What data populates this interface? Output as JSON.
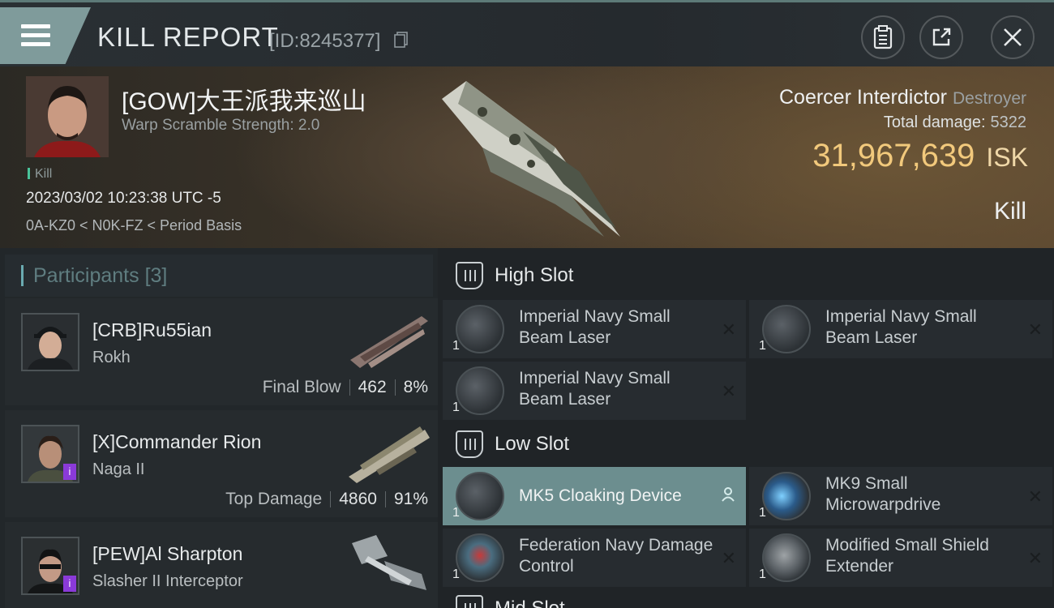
{
  "header": {
    "title": "KILL REPORT",
    "id_text": "[ID:8245377]"
  },
  "victim": {
    "name": "[GOW]大王派我来巡山",
    "warp_scramble": "Warp Scramble Strength: 2.0",
    "tag": "Kill",
    "datetime": "2023/03/02 10:23:38 UTC -5",
    "location": "0A-KZ0 < N0K-FZ < Period Basis",
    "ship_name": "Coercer Interdictor",
    "ship_class": "Destroyer",
    "total_damage_label": "Total damage:",
    "total_damage": "5322",
    "isk_value": "31,967,639",
    "isk_unit": "ISK",
    "result": "Kill"
  },
  "participants": {
    "title": "Participants",
    "count": "[3]",
    "rows": [
      {
        "name": "[CRB]Ru55ian",
        "ship": "Rokh",
        "role": "Final Blow",
        "damage": "462",
        "percent": "8%"
      },
      {
        "name": "[X]Commander Rion",
        "ship": "Naga II",
        "role": "Top Damage",
        "damage": "4860",
        "percent": "91%"
      },
      {
        "name": "[PEW]Al Sharpton",
        "ship": "Slasher II Interceptor"
      }
    ]
  },
  "fitting": {
    "high_slot_label": "High Slot",
    "low_slot_label": "Low Slot",
    "mid_slot_label": "Mid Slot",
    "high": [
      {
        "name": "Imperial Navy Small Beam Laser",
        "qty": "1"
      },
      {
        "name": "Imperial Navy Small Beam Laser",
        "qty": "1"
      },
      {
        "name": "Imperial Navy Small Beam Laser",
        "qty": "1"
      }
    ],
    "low": [
      {
        "name": "MK5 Cloaking Device",
        "qty": "1",
        "state": "dropped-highlighted"
      },
      {
        "name": "MK9 Small Microwarpdrive",
        "qty": "1"
      },
      {
        "name": "Federation Navy Damage Control",
        "qty": "1"
      },
      {
        "name": "Modified Small Shield Extender",
        "qty": "1"
      }
    ]
  },
  "colors": {
    "accent": "#7f9b9b",
    "isk": "#f2c97c",
    "highlight_row": "#6c8e8f",
    "badge": "#8a3ad8"
  }
}
